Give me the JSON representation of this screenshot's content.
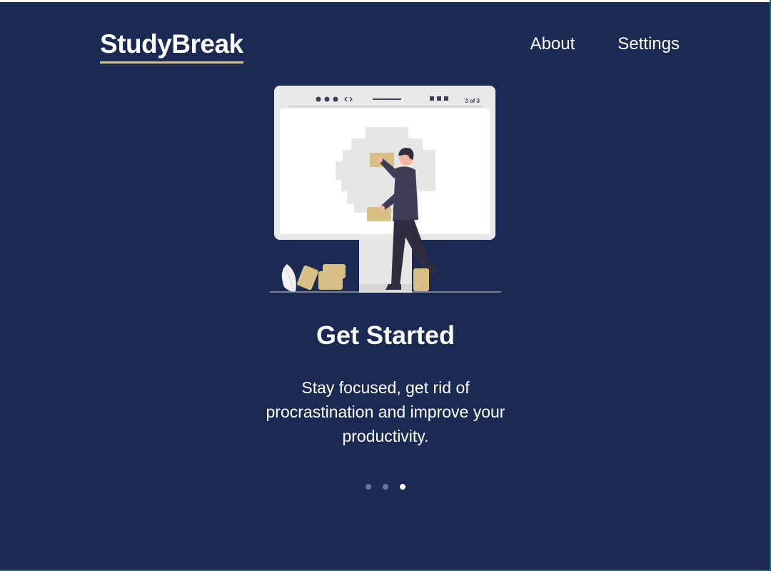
{
  "app": {
    "name": "StudyBreak"
  },
  "nav": {
    "about": "About",
    "settings": "Settings"
  },
  "slide": {
    "title": "Get Started",
    "description": "Stay focused, get rid of procrastination and improve your productivity.",
    "page_indicator": "3 of 3",
    "current_index": 3,
    "total": 3
  },
  "illustration": {
    "icon": "person-arranging-notes-illustration"
  },
  "colors": {
    "background": "#1a2a52",
    "accent": "#d8bf86",
    "text": "#ffffff",
    "dot_inactive": "#6b7694",
    "dot_active": "#ffffff"
  }
}
